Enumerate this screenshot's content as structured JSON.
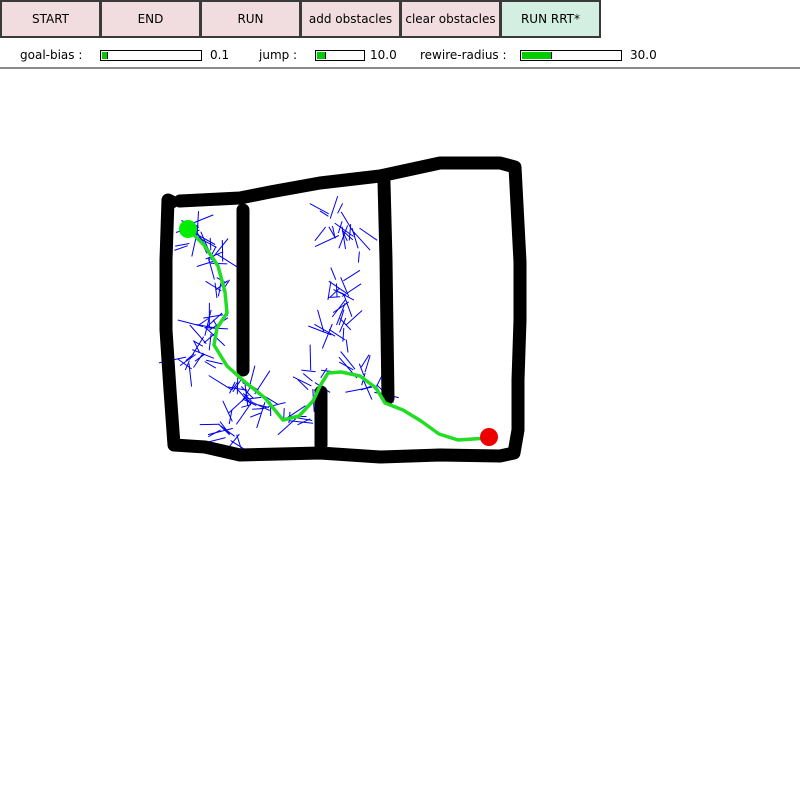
{
  "toolbar": {
    "buttons": [
      {
        "label": "START"
      },
      {
        "label": "END"
      },
      {
        "label": "RUN"
      },
      {
        "label": "add obstacles"
      },
      {
        "label": "clear obstacles"
      },
      {
        "label": "RUN RRT*"
      }
    ]
  },
  "sliders": {
    "goal_bias": {
      "label": "goal-bias  :",
      "value": "0.1",
      "fraction": 0.05
    },
    "jump": {
      "label": "jump  :",
      "value": "10.0",
      "fraction": 0.18
    },
    "rewire_radius": {
      "label": "rewire-radius  :",
      "value": "30.0",
      "fraction": 0.3
    }
  },
  "colors": {
    "button_bg": "#f1dde0",
    "button_active_bg": "#d2efe1",
    "slider_fill": "#00cc00",
    "tree": "#0000ee",
    "path": "#22dd22",
    "start": "#00ee00",
    "goal": "#ee0000",
    "obstacle": "#000000"
  }
}
